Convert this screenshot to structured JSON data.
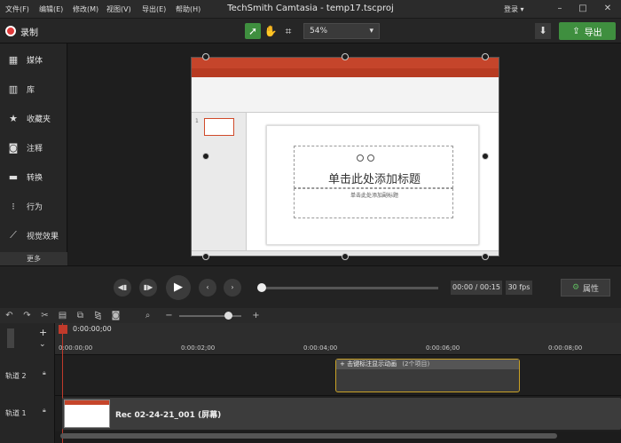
{
  "menubar": {
    "items": [
      "文件(F)",
      "编辑(E)",
      "修改(M)",
      "视图(V)",
      "导出(E)",
      "帮助(H)"
    ],
    "title": "TechSmith Camtasia - temp17.tscproj",
    "login": "登录 ▾"
  },
  "toolbar": {
    "record_label": "录制",
    "zoom_value": "54%",
    "export_label": "导出"
  },
  "sidebar": {
    "items": [
      {
        "label": "媒体",
        "icon": "film-icon"
      },
      {
        "label": "库",
        "icon": "library-icon"
      },
      {
        "label": "收藏夹",
        "icon": "star-icon"
      },
      {
        "label": "注释",
        "icon": "annotation-icon"
      },
      {
        "label": "转换",
        "icon": "transition-icon"
      },
      {
        "label": "行为",
        "icon": "behavior-icon"
      },
      {
        "label": "视觉效果",
        "icon": "wand-icon"
      }
    ],
    "more": "更多"
  },
  "slide": {
    "title_placeholder": "单击此处添加标题",
    "subtitle_placeholder": "单击此处添加副标题",
    "thumb_number": "1"
  },
  "playback": {
    "time": "00:00 / 00:15",
    "fps": "30 fps",
    "properties_label": "属性"
  },
  "timeline": {
    "playhead_time": "0:00:00;00",
    "ruler_ticks": [
      "0:00:00;00",
      "0:00:02;00",
      "0:00:04;00",
      "0:00:06;00",
      "0:00:08;00"
    ],
    "tracks": [
      {
        "name": "轨道 2"
      },
      {
        "name": "轨道 1"
      }
    ],
    "callout_clip_label": "+ 击键标注显示动画",
    "callout_clip_count": "(2个项目)",
    "rec_clip_label": "Rec 02-24-21_001 (屏幕)"
  }
}
